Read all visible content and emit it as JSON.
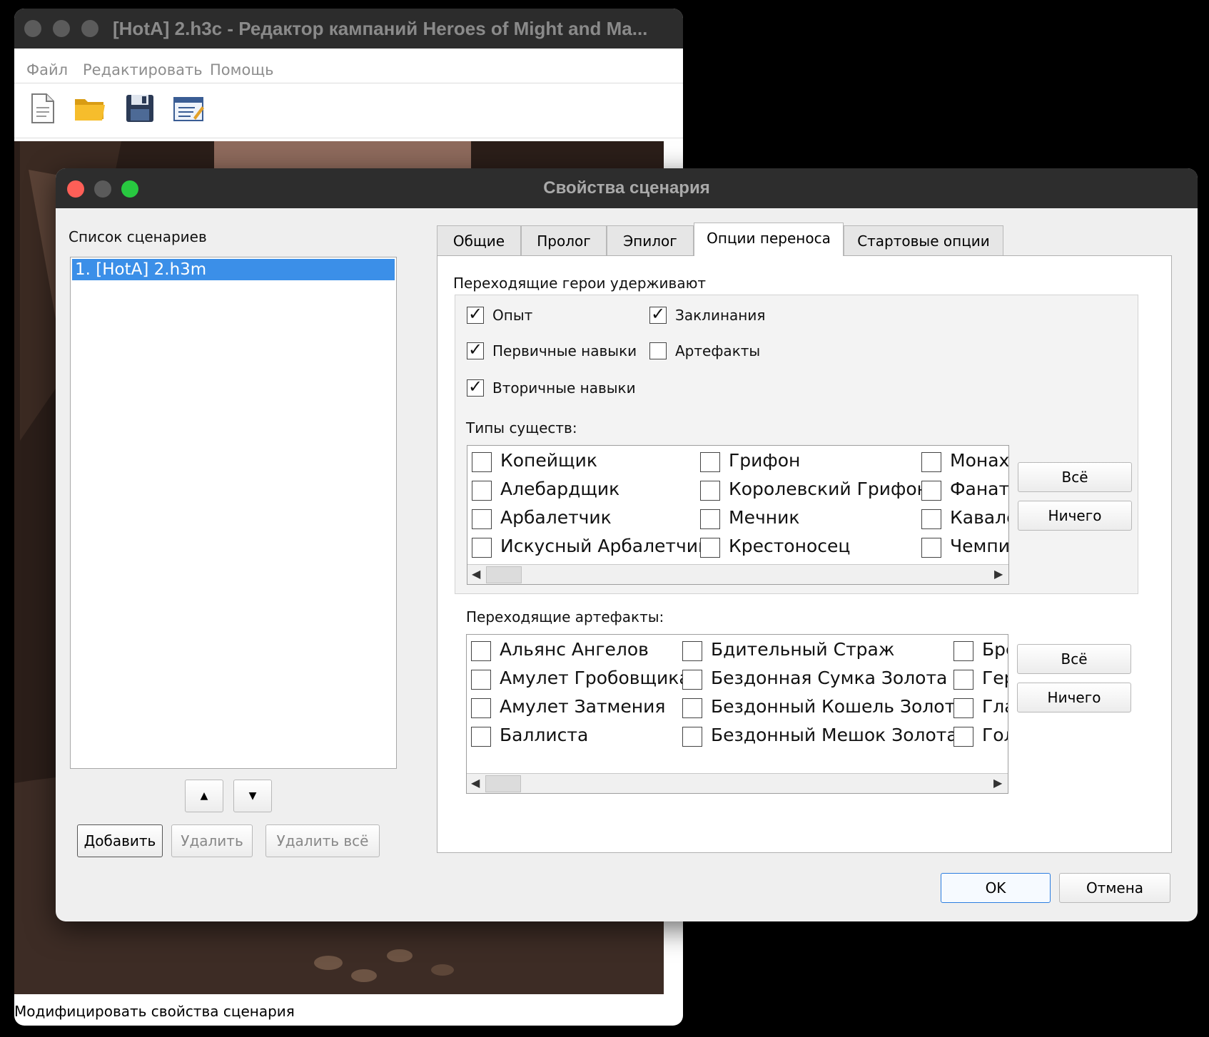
{
  "main_window": {
    "title": "[HotA] 2.h3c - Редактор кампаний Heroes of Might and Ma...",
    "menu": [
      "Файл",
      "Редактировать",
      "Помощь"
    ],
    "toolbar": [
      "new-file-icon",
      "open-folder-icon",
      "save-disk-icon",
      "properties-icon"
    ],
    "status": "Модифицировать свойства сценария"
  },
  "dialog": {
    "title": "Свойства сценария",
    "scenario_list": {
      "label": "Список сценариев",
      "items": [
        "1. [HotA] 2.h3m"
      ]
    },
    "buttons": {
      "up": "▲",
      "down": "▼",
      "add": "Добавить",
      "delete": "Удалить",
      "delete_all": "Удалить всё",
      "ok": "OK",
      "cancel": "Отмена"
    },
    "tabs": [
      "Общие",
      "Пролог",
      "Эпилог",
      "Опции переноса",
      "Стартовые опции"
    ],
    "active_tab": "Опции переноса",
    "transfer": {
      "heroes_keep_label": "Переходящие герои удерживают",
      "keep_options": [
        {
          "label": "Опыт",
          "checked": true
        },
        {
          "label": "Заклинания",
          "checked": true
        },
        {
          "label": "Первичные навыки",
          "checked": true
        },
        {
          "label": "Артефакты",
          "checked": false
        },
        {
          "label": "Вторичные навыки",
          "checked": true
        }
      ],
      "creature_types_label": "Типы существ:",
      "creatures": [
        [
          "Копейщик",
          "Алебардщик",
          "Арбалетчик",
          "Искусный Арбалетчик"
        ],
        [
          "Грифон",
          "Королевский Грифон",
          "Мечник",
          "Крестоносец"
        ],
        [
          "Монах",
          "Фанати",
          "Кавале",
          "Чемпио"
        ]
      ],
      "artifacts_label": "Переходящие артефакты:",
      "artifacts": [
        [
          "Альянс Ангелов",
          "Амулет Гробовщика",
          "Амулет Затмения",
          "Баллиста"
        ],
        [
          "Бдительный Страж",
          "Бездонная Сумка Золота",
          "Бездонный Кошель Золота",
          "Бездонный Мешок Золота"
        ],
        [
          "Бре",
          "Гер",
          "Гла",
          "Гол"
        ]
      ],
      "all_button": "Всё",
      "none_button": "Ничего"
    }
  }
}
